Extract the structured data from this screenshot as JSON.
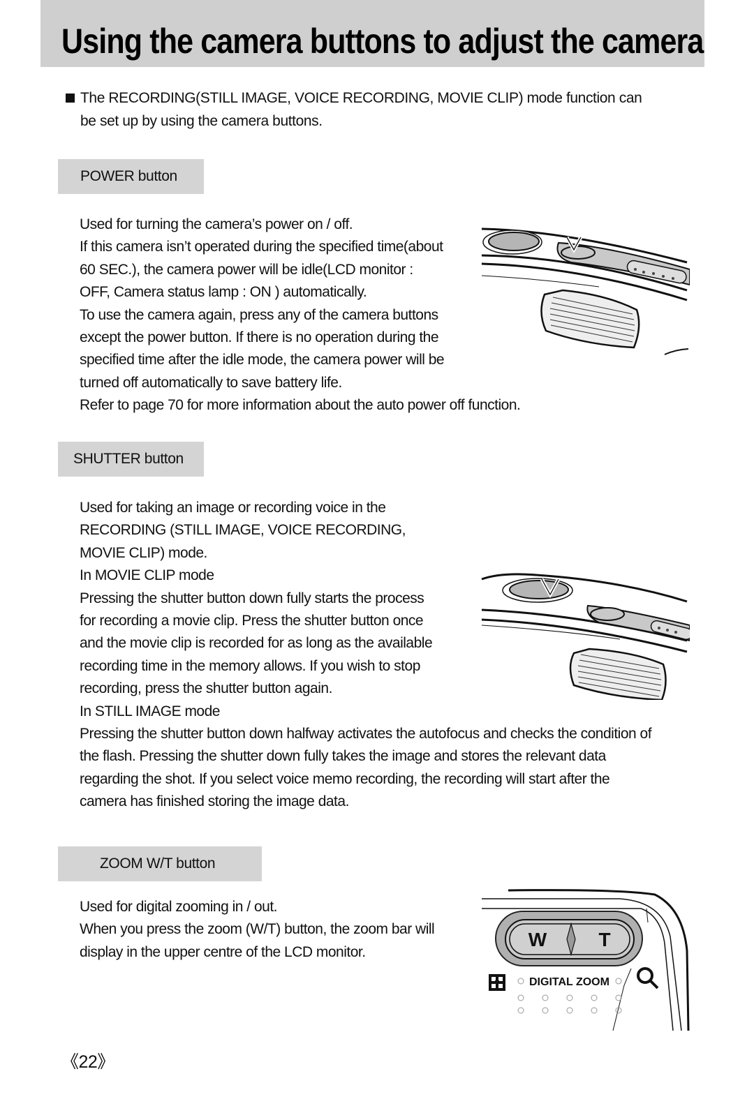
{
  "page": {
    "title": "Using the camera buttons to adjust the camera",
    "intro": [
      "The RECORDING(STILL IMAGE, VOICE RECORDING, MOVIE CLIP) mode function can",
      "be set up by using the camera buttons."
    ],
    "page_number": "《22》"
  },
  "sections": {
    "power": {
      "heading": "POWER button",
      "lines": [
        "Used for turning the camera’s power on / off.",
        "If this camera isn’t operated during the specified time(about",
        "60 SEC.), the camera power will be idle(LCD monitor :",
        "OFF, Camera status lamp : ON ) automatically.",
        "To use the camera again, press any of the camera buttons",
        "except the power button. If there is no operation during the",
        "specified time after the idle mode, the camera power will be",
        "turned off automatically to save battery life.",
        "Refer to page 70 for more information about the auto power off function."
      ]
    },
    "shutter": {
      "heading": "SHUTTER button",
      "lines": [
        "Used for taking an image or recording voice in the",
        "RECORDING (STILL IMAGE, VOICE RECORDING,",
        "MOVIE CLIP) mode.",
        "In MOVIE CLIP mode",
        "Pressing the shutter button down fully starts the process",
        "for recording a movie clip. Press the shutter button once",
        "and the movie clip is recorded for as long as the available",
        "recording time in the memory allows. If you wish to stop",
        "recording, press the shutter button again.",
        "In STILL IMAGE mode",
        "Pressing the shutter button down halfway activates the autofocus and checks the condition of",
        "the flash. Pressing the shutter down fully takes the image and stores the relevant data",
        "regarding the shot. If you select voice memo recording, the recording will start after the",
        "camera has finished storing the image data."
      ]
    },
    "zoom": {
      "heading": "ZOOM W/T button",
      "lines": [
        "Used for digital zooming in / out.",
        "When you press the zoom (W/T) button, the zoom bar will",
        "display in the upper centre of the LCD monitor."
      ],
      "illustration": {
        "w_label": "W",
        "t_label": "T",
        "digital_zoom_label": "DIGITAL ZOOM"
      }
    }
  }
}
